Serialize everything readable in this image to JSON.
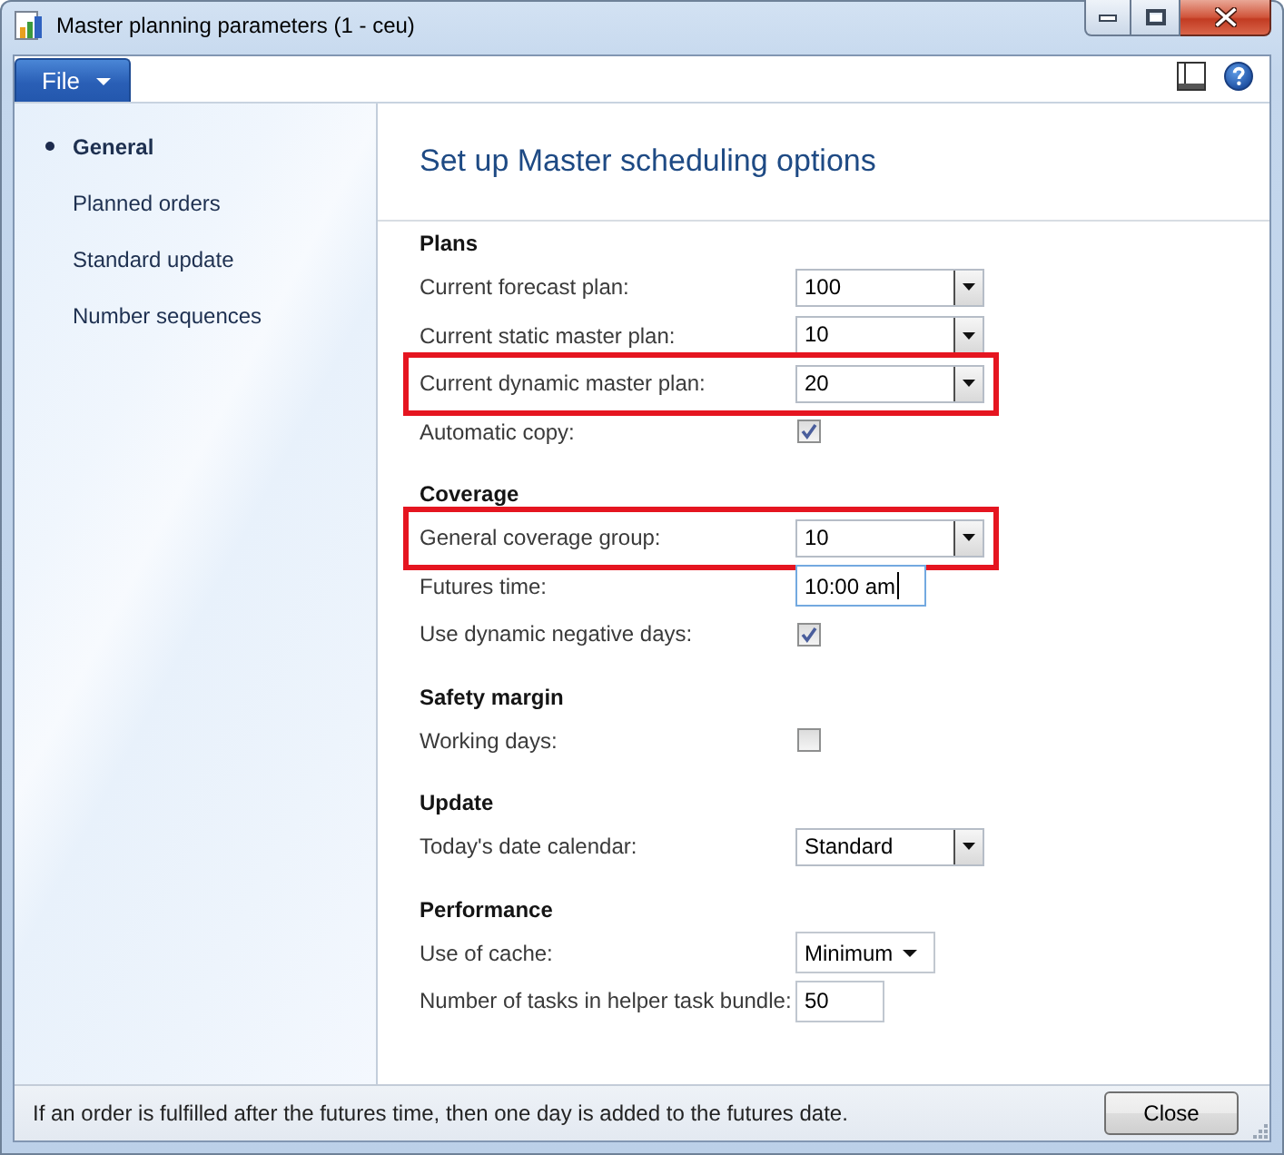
{
  "window": {
    "title": "Master planning parameters (1 - ceu)"
  },
  "toolbar": {
    "file_menu": "File"
  },
  "sidebar": {
    "items": [
      {
        "label": "General",
        "selected": true
      },
      {
        "label": "Planned orders",
        "selected": false
      },
      {
        "label": "Standard update",
        "selected": false
      },
      {
        "label": "Number sequences",
        "selected": false
      }
    ]
  },
  "page": {
    "heading": "Set up Master scheduling options",
    "sections": [
      {
        "title": "Plans",
        "fields": [
          {
            "label": "Current forecast plan:",
            "kind": "combo",
            "value": "100",
            "highlighted": false
          },
          {
            "label": "Current static master plan:",
            "kind": "combo",
            "value": "10",
            "highlighted": false
          },
          {
            "label": "Current dynamic master plan:",
            "kind": "combo",
            "value": "20",
            "highlighted": true
          },
          {
            "label": "Automatic copy:",
            "kind": "checkbox",
            "checked": true,
            "highlighted": false
          }
        ]
      },
      {
        "title": "Coverage",
        "fields": [
          {
            "label": "General coverage group:",
            "kind": "combo",
            "value": "10",
            "highlighted": true
          },
          {
            "label": "Futures time:",
            "kind": "text",
            "value": "10:00 am",
            "focused": true,
            "highlighted": false
          },
          {
            "label": "Use dynamic negative days:",
            "kind": "checkbox",
            "checked": true,
            "highlighted": false
          }
        ]
      },
      {
        "title": "Safety margin",
        "fields": [
          {
            "label": "Working days:",
            "kind": "checkbox",
            "checked": false,
            "highlighted": false
          }
        ]
      },
      {
        "title": "Update",
        "fields": [
          {
            "label": "Today's date calendar:",
            "kind": "combo",
            "value": "Standard",
            "highlighted": false
          }
        ]
      },
      {
        "title": "Performance",
        "fields": [
          {
            "label": "Use of cache:",
            "kind": "dropdown",
            "value": "Minimum",
            "highlighted": false
          },
          {
            "label": "Number of tasks in helper task bundle:",
            "kind": "text",
            "value": "50",
            "focused": false,
            "highlighted": false
          }
        ]
      }
    ]
  },
  "status_bar": {
    "message": "If an order is fulfilled after the futures time, then one day is added to the futures date.",
    "close_button": "Close"
  }
}
